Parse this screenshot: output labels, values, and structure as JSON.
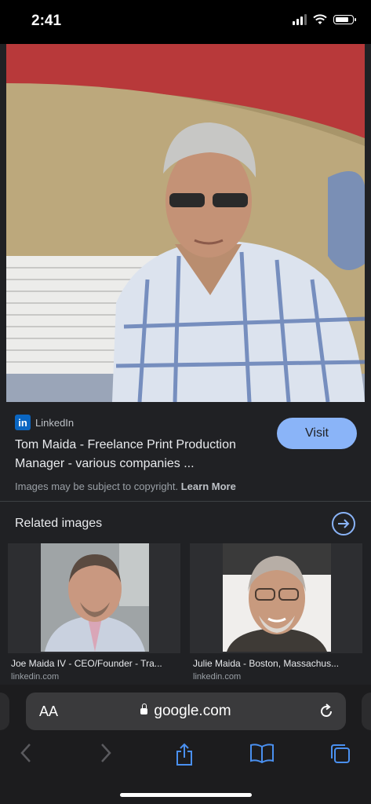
{
  "status_bar": {
    "time": "2:41"
  },
  "result": {
    "source": "LinkedIn",
    "source_logo": "in",
    "title": "Tom Maida - Freelance Print Production Manager - various companies ...",
    "visit_label": "Visit",
    "copyright_text": "Images may be subject to copyright.",
    "learn_more": "Learn More"
  },
  "related": {
    "title": "Related images",
    "items": [
      {
        "caption": "Joe Maida IV - CEO/Founder - Tra...",
        "site": "linkedin.com"
      },
      {
        "caption": "Julie Maida - Boston, Massachus...",
        "site": "linkedin.com"
      }
    ]
  },
  "browser": {
    "aa_label": "AA",
    "url": "google.com"
  },
  "colors": {
    "background": "#202124",
    "accent": "#8ab4f8",
    "linkedin": "#0a66c2",
    "safari_toolbar": "#1c1c1e"
  },
  "icons": [
    "wifi-icon",
    "battery-icon",
    "arrow-right-icon",
    "lock-icon",
    "reload-icon",
    "back-icon",
    "forward-icon",
    "share-icon",
    "bookmarks-icon",
    "tabs-icon"
  ]
}
